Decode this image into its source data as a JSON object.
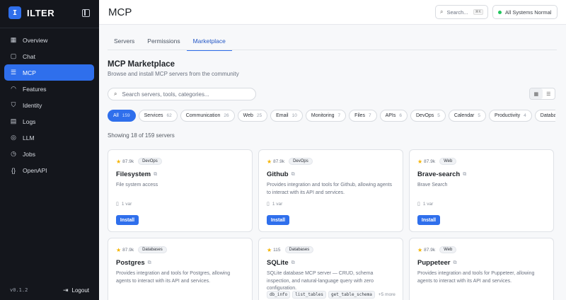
{
  "app": {
    "logo_letter": "I",
    "name": "ILTER",
    "version": "v0.1.2",
    "logout_label": "Logout"
  },
  "sidebar": {
    "items": [
      {
        "label": "Overview",
        "icon": "grid-icon",
        "glyph": "▦",
        "active": false
      },
      {
        "label": "Chat",
        "icon": "chat-icon",
        "glyph": "▢",
        "active": false
      },
      {
        "label": "MCP",
        "icon": "server-icon",
        "glyph": "☰",
        "active": true
      },
      {
        "label": "Features",
        "icon": "gauge-icon",
        "glyph": "◠",
        "active": false
      },
      {
        "label": "Identity",
        "icon": "shield-icon",
        "glyph": "⛉",
        "active": false
      },
      {
        "label": "Logs",
        "icon": "file-icon",
        "glyph": "▤",
        "active": false
      },
      {
        "label": "LLM",
        "icon": "bot-icon",
        "glyph": "◎",
        "active": false
      },
      {
        "label": "Jobs",
        "icon": "timer-icon",
        "glyph": "◷",
        "active": false
      },
      {
        "label": "OpenAPI",
        "icon": "braces-icon",
        "glyph": "{}",
        "active": false
      }
    ]
  },
  "header": {
    "title": "MCP",
    "search_label": "Search...",
    "search_shortcut": "⌘K",
    "status_text": "All Systems Normal",
    "status_color": "#22c55e"
  },
  "tabs": [
    {
      "label": "Servers",
      "active": false
    },
    {
      "label": "Permissions",
      "active": false
    },
    {
      "label": "Marketplace",
      "active": true
    }
  ],
  "marketplace": {
    "title": "MCP Marketplace",
    "subtitle": "Browse and install MCP servers from the community",
    "search_placeholder": "Search servers, tools, categories...",
    "showing_text": "Showing 18 of 159 servers",
    "accent_color": "#2f6fec"
  },
  "filters": [
    {
      "label": "All",
      "count": "159",
      "active": true
    },
    {
      "label": "Services",
      "count": "62"
    },
    {
      "label": "Communication",
      "count": "26"
    },
    {
      "label": "Web",
      "count": "25"
    },
    {
      "label": "Email",
      "count": "10"
    },
    {
      "label": "Monitoring",
      "count": "7"
    },
    {
      "label": "Files",
      "count": "7"
    },
    {
      "label": "APIs",
      "count": "6"
    },
    {
      "label": "DevOps",
      "count": "5"
    },
    {
      "label": "Calendar",
      "count": "5"
    },
    {
      "label": "Productivity",
      "count": "4"
    },
    {
      "label": "Databases",
      "count": ""
    }
  ],
  "cards": [
    {
      "stars": "87.9k",
      "tag": "DevOps",
      "name": "Filesystem",
      "desc": "File system access",
      "vars": "1 var",
      "install": "Install"
    },
    {
      "stars": "87.9k",
      "tag": "DevOps",
      "name": "Github",
      "desc": "Provides integration and tools for Github, allowing agents to interact with its API and services.",
      "vars": "1 var",
      "install": "Install"
    },
    {
      "stars": "87.9k",
      "tag": "Web",
      "name": "Brave-search",
      "desc": "Brave Search",
      "vars": "1 var",
      "install": "Install"
    },
    {
      "stars": "87.9k",
      "tag": "Databases",
      "name": "Postgres",
      "desc": "Provides integration and tools for Postgres, allowing agents to interact with its API and services."
    },
    {
      "stars": "115",
      "tag": "Databases",
      "name": "SQLite",
      "desc": "SQLite database MCP server — CRUD, schema inspection, and natural-language query with zero configuration.",
      "tools": [
        "db_info",
        "list_tables",
        "get_table_schema"
      ],
      "more": "+5 more"
    },
    {
      "stars": "87.9k",
      "tag": "Web",
      "name": "Puppeteer",
      "desc": "Provides integration and tools for Puppeteer, allowing agents to interact with its API and services."
    }
  ]
}
